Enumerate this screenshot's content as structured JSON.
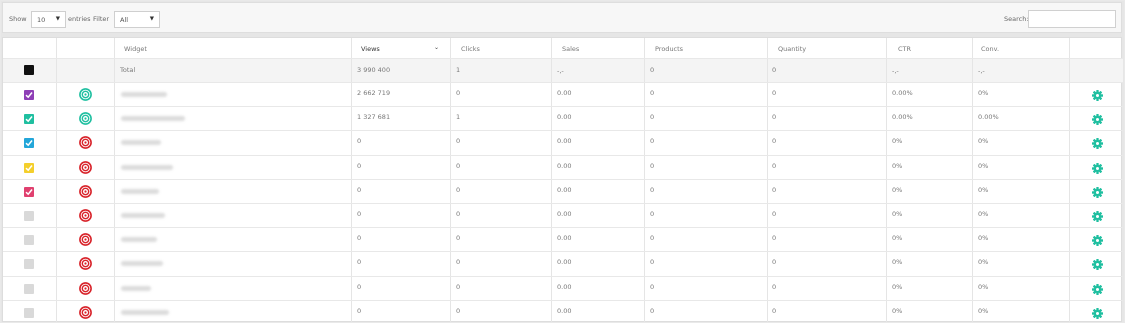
{
  "toolbar": {
    "show_label": "Show",
    "entries_value": "10",
    "entries_label": "entries",
    "filter_label": "Filter",
    "filter_value": "All",
    "search_label": "Search:"
  },
  "columns": [
    "Widget",
    "Views",
    "Clicks",
    "Sales",
    "Products",
    "Quantity",
    "CTR",
    "Conv."
  ],
  "total": {
    "label": "Total",
    "views": "3 990 400",
    "clicks": "1",
    "sales": "-,-",
    "products": "0",
    "quantity": "0",
    "ctr": "-,-",
    "conv": "-,-"
  },
  "rows": [
    {
      "color": "#8e3fb6",
      "checked": true,
      "status": "active",
      "views": "2 662 719",
      "clicks": "0",
      "sales": "0.00",
      "products": "0",
      "quantity": "0",
      "ctr": "0.00%",
      "conv": "0%"
    },
    {
      "color": "#1fbfa0",
      "checked": true,
      "status": "active",
      "views": "1 327 681",
      "clicks": "1",
      "sales": "0.00",
      "products": "0",
      "quantity": "0",
      "ctr": "0.00%",
      "conv": "0.00%"
    },
    {
      "color": "#23a6d9",
      "checked": true,
      "status": "inactive",
      "views": "0",
      "clicks": "0",
      "sales": "0.00",
      "products": "0",
      "quantity": "0",
      "ctr": "0%",
      "conv": "0%"
    },
    {
      "color": "#f4cf2c",
      "checked": true,
      "status": "inactive",
      "views": "0",
      "clicks": "0",
      "sales": "0.00",
      "products": "0",
      "quantity": "0",
      "ctr": "0%",
      "conv": "0%"
    },
    {
      "color": "#e0406f",
      "checked": true,
      "status": "inactive",
      "views": "0",
      "clicks": "0",
      "sales": "0.00",
      "products": "0",
      "quantity": "0",
      "ctr": "0%",
      "conv": "0%"
    },
    {
      "color": "#d9d9d9",
      "checked": false,
      "status": "inactive",
      "views": "0",
      "clicks": "0",
      "sales": "0.00",
      "products": "0",
      "quantity": "0",
      "ctr": "0%",
      "conv": "0%"
    },
    {
      "color": "#d9d9d9",
      "checked": false,
      "status": "inactive",
      "views": "0",
      "clicks": "0",
      "sales": "0.00",
      "products": "0",
      "quantity": "0",
      "ctr": "0%",
      "conv": "0%"
    },
    {
      "color": "#d9d9d9",
      "checked": false,
      "status": "inactive",
      "views": "0",
      "clicks": "0",
      "sales": "0.00",
      "products": "0",
      "quantity": "0",
      "ctr": "0%",
      "conv": "0%"
    },
    {
      "color": "#d9d9d9",
      "checked": false,
      "status": "inactive",
      "views": "0",
      "clicks": "0",
      "sales": "0.00",
      "products": "0",
      "quantity": "0",
      "ctr": "0%",
      "conv": "0%"
    },
    {
      "color": "#d9d9d9",
      "checked": false,
      "status": "inactive",
      "views": "0",
      "clicks": "0",
      "sales": "0.00",
      "products": "0",
      "quantity": "0",
      "ctr": "0%",
      "conv": "0%"
    }
  ],
  "colors": {
    "active_target": "#1fbfa0",
    "inactive_target": "#d8232a",
    "gear": "#1fbfa0"
  },
  "icons": {
    "status_active": "target-icon-green",
    "status_inactive": "target-icon-red",
    "row_action": "gear-icon",
    "sort": "chevron-down-icon"
  }
}
